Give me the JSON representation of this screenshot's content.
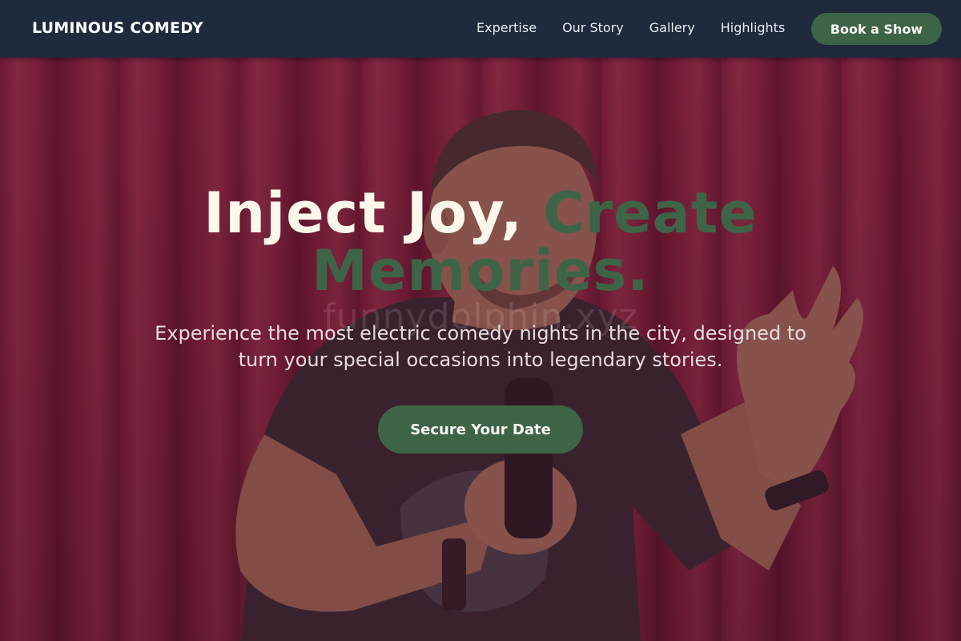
{
  "header": {
    "logo": "LUMINOUS COMEDY",
    "nav": [
      "Expertise",
      "Our Story",
      "Gallery",
      "Highlights"
    ],
    "cta_label": "Book a Show"
  },
  "hero": {
    "headline_white": "Inject Joy,",
    "headline_accent": "Create Memories.",
    "watermark": "funnydolphin.xyz",
    "subtitle": "Experience the most electric comedy nights in the city, designed to turn your special occasions into legendary stories.",
    "cta_label": "Secure Your Date"
  },
  "colors": {
    "navbar_bg": "#1f2a3c",
    "accent_green": "#3e6448",
    "curtain_red": "#a82747",
    "headline_white": "#fbf7ea"
  },
  "icons": {
    "background": "comedian-on-stage-photo"
  }
}
